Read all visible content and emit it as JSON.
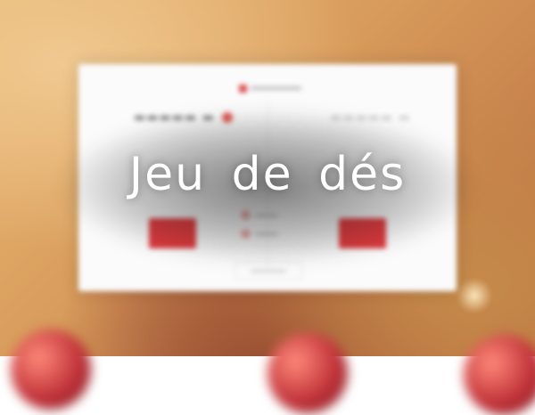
{
  "title": "Jeu de dés",
  "colors": {
    "accent_red": "#e03a3e",
    "panel_bg": "#fbfbfb",
    "title_text": "#ffffff"
  },
  "icons": {
    "logo": "dice-logo-icon",
    "active_player": "active-player-dot-icon",
    "roll": "roll-dice-icon",
    "hold": "hold-icon"
  }
}
